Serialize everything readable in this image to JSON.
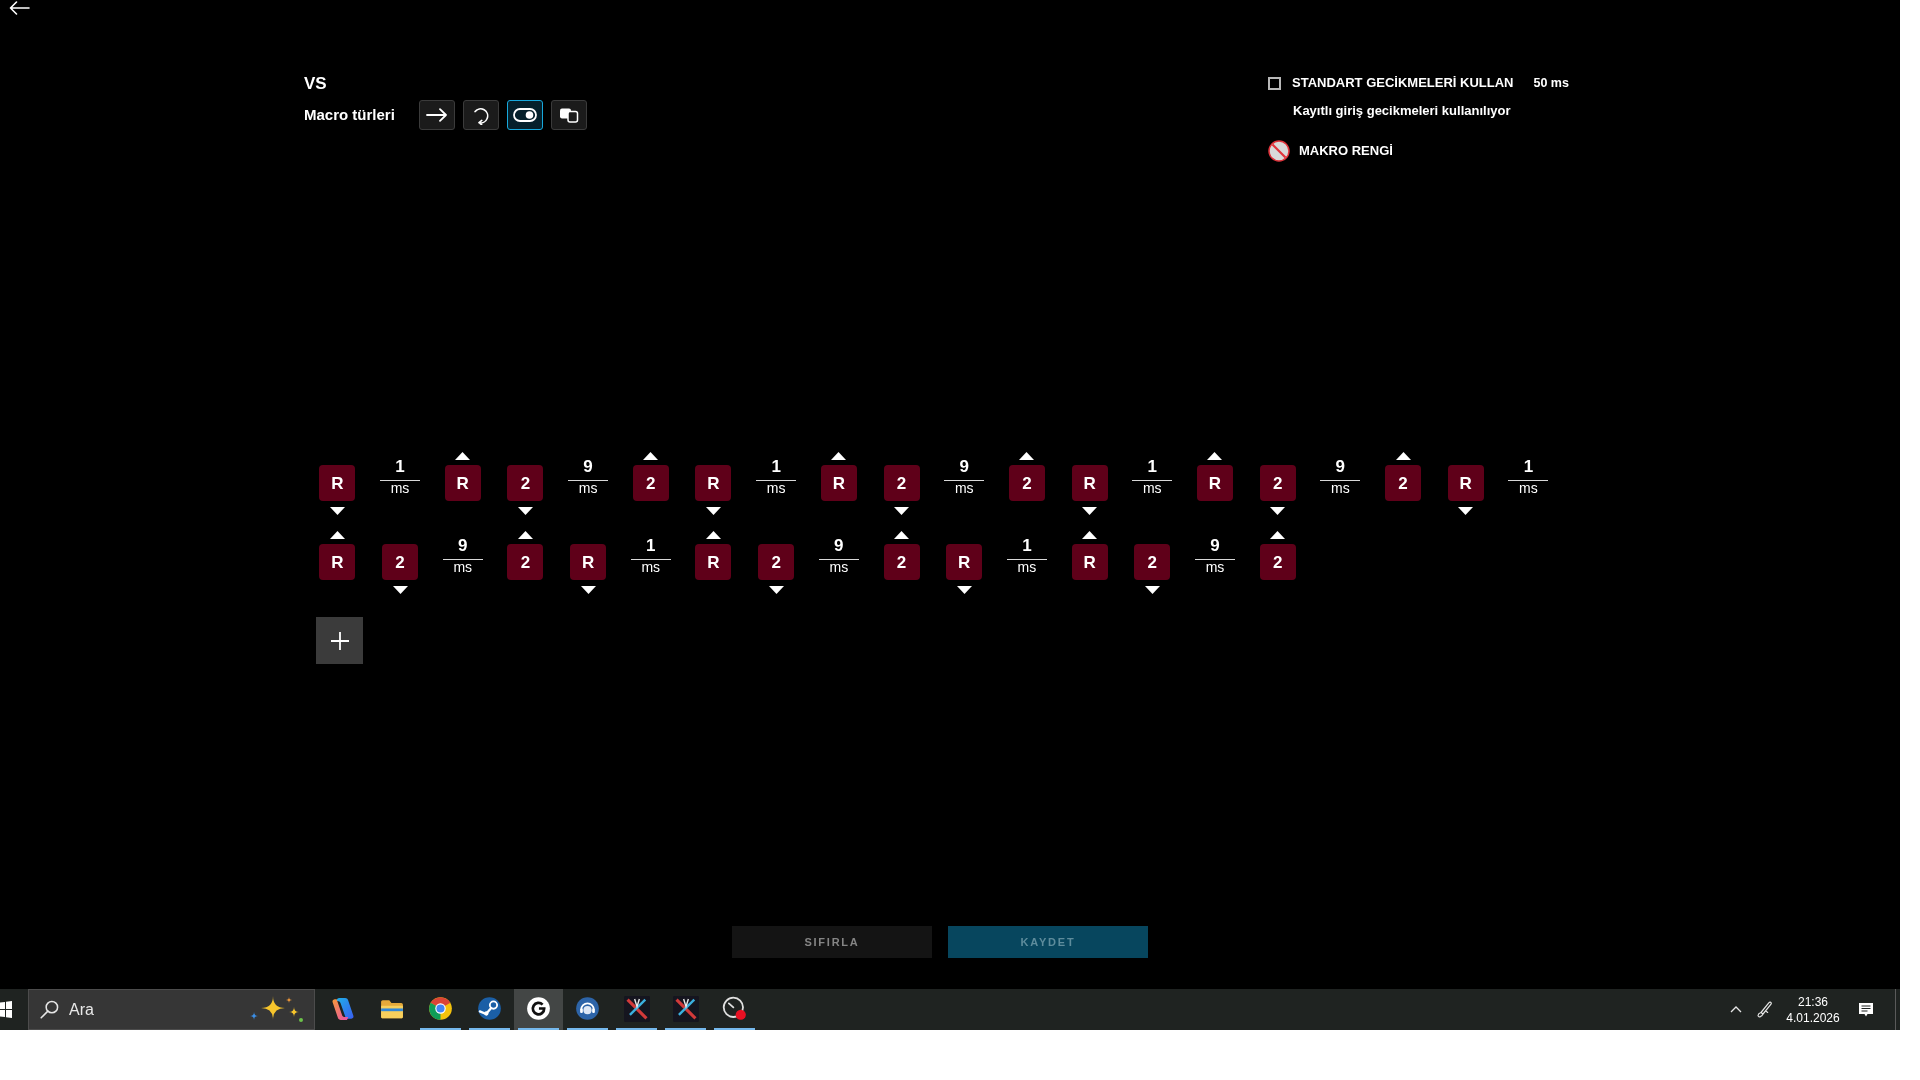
{
  "header": {
    "title": "VS",
    "macro_types_label": "Macro türleri",
    "macro_types": [
      {
        "kind": "arrow",
        "selected": false
      },
      {
        "kind": "repeat",
        "selected": false
      },
      {
        "kind": "toggle",
        "selected": true
      },
      {
        "kind": "stack",
        "selected": false
      }
    ]
  },
  "settings": {
    "standard_delays": {
      "label": "STANDART GECİKMELERİ KULLAN",
      "checked": false,
      "value": "50 ms",
      "note": "Kayıtlı giriş gecikmeleri kullanılıyor"
    },
    "macro_color": {
      "label": "MAKRO RENGİ"
    }
  },
  "sequence": {
    "events": [
      {
        "kind": "key_down",
        "label": "R"
      },
      {
        "kind": "delay",
        "value": "1",
        "unit": "ms"
      },
      {
        "kind": "key_up",
        "label": "R"
      },
      {
        "kind": "key_down",
        "label": "2"
      },
      {
        "kind": "delay",
        "value": "9",
        "unit": "ms"
      },
      {
        "kind": "key_up",
        "label": "2"
      },
      {
        "kind": "key_down",
        "label": "R"
      },
      {
        "kind": "delay",
        "value": "1",
        "unit": "ms"
      },
      {
        "kind": "key_up",
        "label": "R"
      },
      {
        "kind": "key_down",
        "label": "2"
      },
      {
        "kind": "delay",
        "value": "9",
        "unit": "ms"
      },
      {
        "kind": "key_up",
        "label": "2"
      },
      {
        "kind": "key_down",
        "label": "R"
      },
      {
        "kind": "delay",
        "value": "1",
        "unit": "ms"
      },
      {
        "kind": "key_up",
        "label": "R"
      },
      {
        "kind": "key_down",
        "label": "2"
      },
      {
        "kind": "delay",
        "value": "9",
        "unit": "ms"
      },
      {
        "kind": "key_up",
        "label": "2"
      },
      {
        "kind": "key_down",
        "label": "R"
      },
      {
        "kind": "delay",
        "value": "1",
        "unit": "ms"
      },
      {
        "kind": "key_up",
        "label": "R"
      },
      {
        "kind": "key_down",
        "label": "2"
      },
      {
        "kind": "delay",
        "value": "9",
        "unit": "ms"
      },
      {
        "kind": "key_up",
        "label": "2"
      },
      {
        "kind": "key_down",
        "label": "R"
      },
      {
        "kind": "delay",
        "value": "1",
        "unit": "ms"
      },
      {
        "kind": "key_up",
        "label": "R"
      },
      {
        "kind": "key_down",
        "label": "2"
      },
      {
        "kind": "delay",
        "value": "9",
        "unit": "ms"
      },
      {
        "kind": "key_up",
        "label": "2"
      },
      {
        "kind": "key_down",
        "label": "R"
      },
      {
        "kind": "delay",
        "value": "1",
        "unit": "ms"
      },
      {
        "kind": "key_up",
        "label": "R"
      },
      {
        "kind": "key_down",
        "label": "2"
      },
      {
        "kind": "delay",
        "value": "9",
        "unit": "ms"
      },
      {
        "kind": "key_up",
        "label": "2"
      }
    ]
  },
  "actions": [
    {
      "label": "SIFIRLA",
      "kind": "secondary"
    },
    {
      "label": "KAYDET",
      "kind": "primary"
    }
  ],
  "taskbar": {
    "search": {
      "placeholder": "Ara"
    },
    "apps": [
      {
        "kind": "swirl",
        "running": false,
        "active": false
      },
      {
        "kind": "folder",
        "running": false,
        "active": false
      },
      {
        "kind": "wheel",
        "running": true,
        "active": false
      },
      {
        "kind": "piston",
        "running": true,
        "active": false
      },
      {
        "kind": "ring",
        "running": true,
        "active": true
      },
      {
        "kind": "headset",
        "running": true,
        "active": false
      },
      {
        "kind": "tile",
        "running": true,
        "active": false
      },
      {
        "kind": "tile",
        "running": true,
        "active": false
      },
      {
        "kind": "gauge",
        "running": true,
        "active": false
      }
    ],
    "clock": {
      "time": "21:36",
      "date": "4.01.2026"
    }
  }
}
